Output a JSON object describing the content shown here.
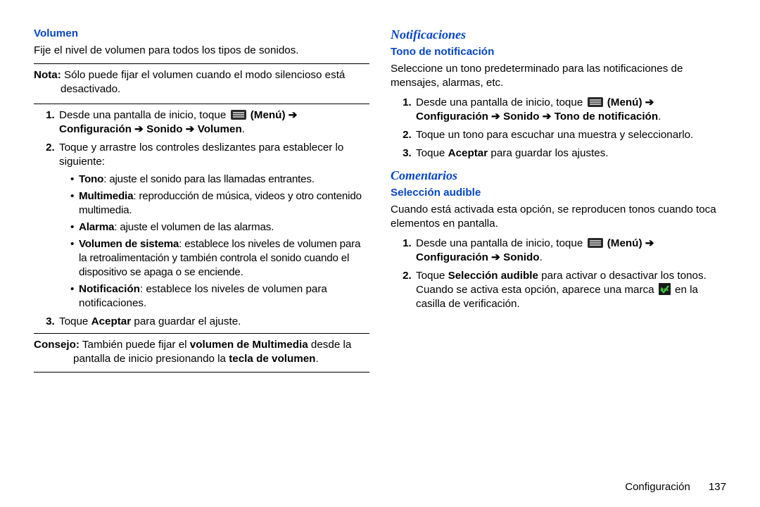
{
  "left": {
    "h_volumen": "Volumen",
    "p_intro": "Fije el nivel de volumen para todos los tipos de sonidos.",
    "nota_label": "Nota:",
    "nota_text": " Sólo puede fijar el volumen cuando el modo silencioso está desactivado.",
    "step1_a": "Desde una pantalla de inicio, toque ",
    "step1_menu": " (Menú) ",
    "step1_arrow": "➔",
    "step1_path_b": "Configuración ",
    "step1_path_c": " Sonido ",
    "step1_path_d": " Volumen",
    "step2": "Toque y arrastre los controles deslizantes para establecer lo siguiente:",
    "b_tono_label": "Tono",
    "b_tono_text": ": ajuste el sonido para las llamadas entrantes.",
    "b_mm_label": "Multimedia",
    "b_mm_text": ": reproducción de música, videos y otro contenido multimedia.",
    "b_al_label": "Alarma",
    "b_al_text": ": ajuste el volumen de las alarmas.",
    "b_vs_label": "Volumen de sistema",
    "b_vs_text": ": establece los niveles de volumen para la retroalimentación y también controla el sonido cuando el dispositivo se apaga o se enciende.",
    "b_no_label": "Notificación",
    "b_no_text": ": establece los niveles de volumen para notificaciones.",
    "step3_a": "Toque ",
    "step3_b": "Aceptar",
    "step3_c": " para guardar el ajuste.",
    "consejo_label": "Consejo:",
    "consejo_a": " También puede fijar el ",
    "consejo_b": "volumen de Multimedia",
    "consejo_c": " desde la pantalla de inicio presionando la ",
    "consejo_d": "tecla de volumen",
    "consejo_e": "."
  },
  "right": {
    "h_notif": "Notificaciones",
    "h_tono": "Tono de notificación",
    "p_tono": "Seleccione un tono predeterminado para las notificaciones de mensajes, alarmas, etc.",
    "t_step1_a": "Desde una pantalla de inicio, toque ",
    "t_step1_menu": " (Menú) ",
    "t_arrow": "➔",
    "t_step1_b": "Configuración ",
    "t_step1_c": " Sonido ",
    "t_step1_d": " Tono de notificación",
    "t_step2": "Toque un tono para escuchar una muestra y seleccionarlo.",
    "t_step3_a": "Toque ",
    "t_step3_b": "Aceptar",
    "t_step3_c": " para guardar los ajustes.",
    "h_com": "Comentarios",
    "h_sel": "Selección audible",
    "p_sel": "Cuando está activada esta opción, se reproducen tonos cuando toca elementos en pantalla.",
    "s_step1_a": "Desde una pantalla de inicio, toque ",
    "s_step1_menu": " (Menú) ",
    "s_arrow": "➔",
    "s_step1_b": "Configuración ",
    "s_step1_c": " Sonido",
    "s_step2_a": "Toque ",
    "s_step2_b": "Selección audible",
    "s_step2_c": " para activar o desactivar los tonos. Cuando se activa esta opción, aparece una marca ",
    "s_step2_d": " en la casilla de verificación."
  },
  "footer": {
    "section": "Configuración",
    "page": "137"
  }
}
